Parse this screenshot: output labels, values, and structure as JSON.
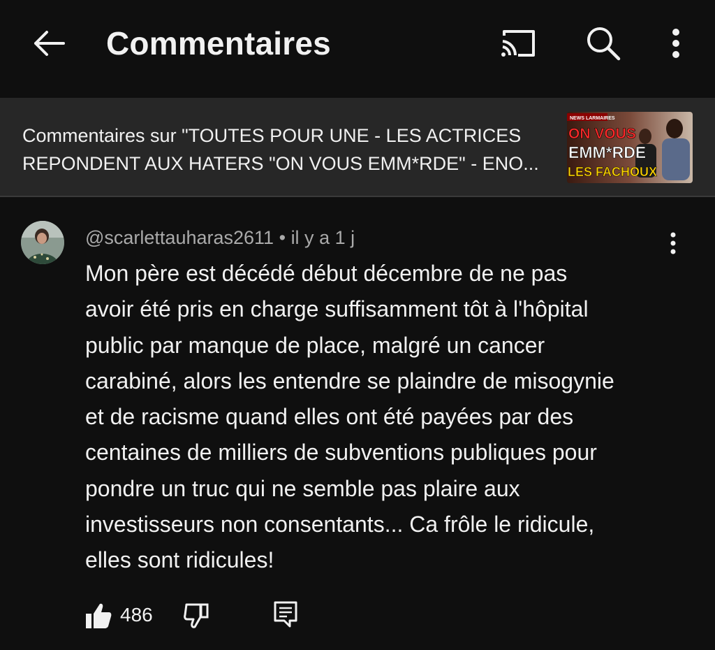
{
  "header": {
    "title": "Commentaires",
    "icons": {
      "back": "arrow-left-icon",
      "cast": "cast-icon",
      "search": "search-icon",
      "more": "more-vertical-icon"
    }
  },
  "video": {
    "title_line1": "Commentaires sur \"TOUTES POUR UNE - LES ACTRICES",
    "title_line2": "REPONDENT AUX HATERS \"ON VOUS EMM*RDE\" - ENO...",
    "thumbnail_text": {
      "tag": "NEWS LARMAIRES",
      "line1": "ON VOUS",
      "line2": "EMM*RDE",
      "line3": "LES FACHOUX"
    }
  },
  "comment": {
    "author": "@scarlettauharas2611",
    "separator": "•",
    "time": "il y a 1 j",
    "lines": [
      "Mon père est décédé début décembre de ne pas",
      "avoir été pris en charge suffisamment tôt à l'hôpital",
      "public par manque de place, malgré un cancer",
      "carabiné, alors les entendre se plaindre de misogynie",
      "et de racisme quand elles ont été payées par des",
      "centaines de milliers de subventions publiques pour",
      "pondre un truc qui ne semble pas plaire aux",
      "investisseurs non consentants... Ca frôle le ridicule,",
      "elles sont ridicules!"
    ],
    "likes": "486",
    "icons": {
      "like": "thumbs-up-icon",
      "dislike": "thumbs-down-icon",
      "reply": "reply-icon",
      "more": "more-vertical-icon"
    }
  },
  "colors": {
    "background": "#0f0f0f",
    "banner": "#272727",
    "text": "#f1f1f1",
    "secondary_text": "#aaaaaa"
  }
}
